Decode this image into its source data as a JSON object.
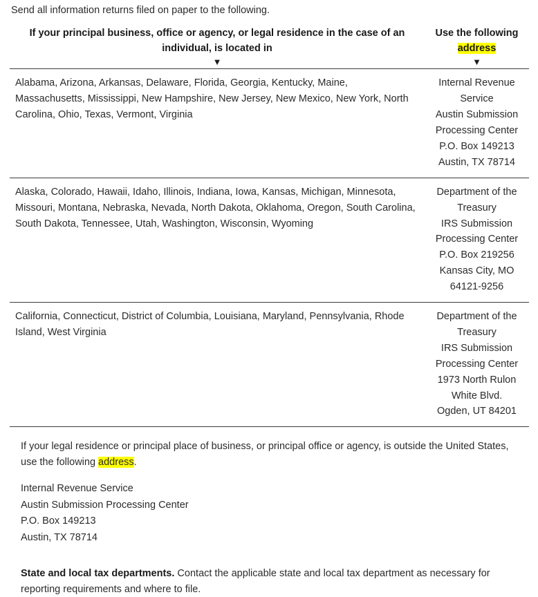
{
  "intro": {
    "text": "Send all information returns filed on paper to the following."
  },
  "table": {
    "headers": {
      "location": "If your principal business, office or agency, or legal residence in the case of an individual, is located in",
      "address_prefix": "Use the following",
      "address_highlight": "address",
      "arrow_glyph": "▼"
    },
    "rows": [
      {
        "locations": "Alabama, Arizona, Arkansas, Delaware, Florida, Georgia, Kentucky, Maine, Massachusetts, Mississippi, New Hampshire, New Jersey, New Mexico, New York, North Carolina, Ohio, Texas, Vermont, Virginia",
        "address": [
          "Internal Revenue",
          "Service",
          "Austin Submission",
          "Processing Center",
          "P.O. Box 149213",
          "Austin, TX 78714"
        ]
      },
      {
        "locations": "Alaska, Colorado, Hawaii, Idaho, Illinois, Indiana, Iowa, Kansas, Michigan, Minnesota, Missouri, Montana, Nebraska, Nevada, North Dakota, Oklahoma, Oregon, South Carolina, South Dakota, Tennessee, Utah, Washington, Wisconsin, Wyoming",
        "address": [
          "Department of the",
          "Treasury",
          "IRS Submission",
          "Processing Center",
          "P.O. Box 219256",
          "Kansas City, MO",
          "64121-9256"
        ]
      },
      {
        "locations": "California, Connecticut, District of Columbia, Louisiana, Maryland, Pennsylvania, Rhode Island, West Virginia",
        "address": [
          "Department of the",
          "Treasury",
          "IRS Submission",
          "Processing Center",
          "1973 North Rulon",
          "White Blvd.",
          "Ogden, UT 84201"
        ]
      }
    ]
  },
  "outside_us": {
    "paragraph_before": "If your legal residence or principal place of business, or principal office or agency, is outside the United States, use the following ",
    "highlight": "address",
    "paragraph_after": ".",
    "address": [
      "Internal Revenue Service",
      "Austin Submission Processing Center",
      "P.O. Box 149213",
      "Austin, TX 78714"
    ]
  },
  "state_local": {
    "bold_lead": "State and local tax departments.",
    "body": " Contact the applicable state and local tax department as necessary for reporting requirements and where to file."
  },
  "colors": {
    "highlight": "#ffff00",
    "text": "#2b2b2b",
    "heading": "#1a1a1a",
    "rule": "#3a3a3a"
  }
}
